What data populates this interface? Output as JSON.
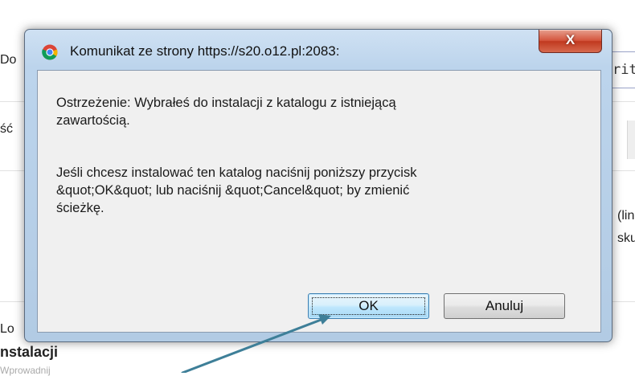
{
  "background": {
    "left_fragments": [
      "Do",
      "ść",
      "Lo",
      "nstalacji",
      "Wprowadnij"
    ],
    "right_fragments": [
      "(lin",
      "sku"
    ],
    "field_text": "rit"
  },
  "dialog": {
    "title": "Komunikat ze strony https://s20.o12.pl:2083:",
    "close_label": "X",
    "message_line1": "Ostrzeżenie: Wybrałeś do instalacji z katalogu z istniejącą zawartością.",
    "message_line2": "Jeśli chcesz instalować ten katalog naciśnij poniższy przycisk &quot;OK&quot; lub naciśnij &quot;Cancel&quot; by zmienić ścieżkę.",
    "ok_label": "OK",
    "cancel_label": "Anuluj"
  },
  "colors": {
    "arrow": "#3e7f98",
    "title_bar": "#bcd4ec",
    "close_button": "#c84a32"
  },
  "icons": {
    "title_icon": "chrome-icon",
    "close_icon": "close-icon"
  }
}
